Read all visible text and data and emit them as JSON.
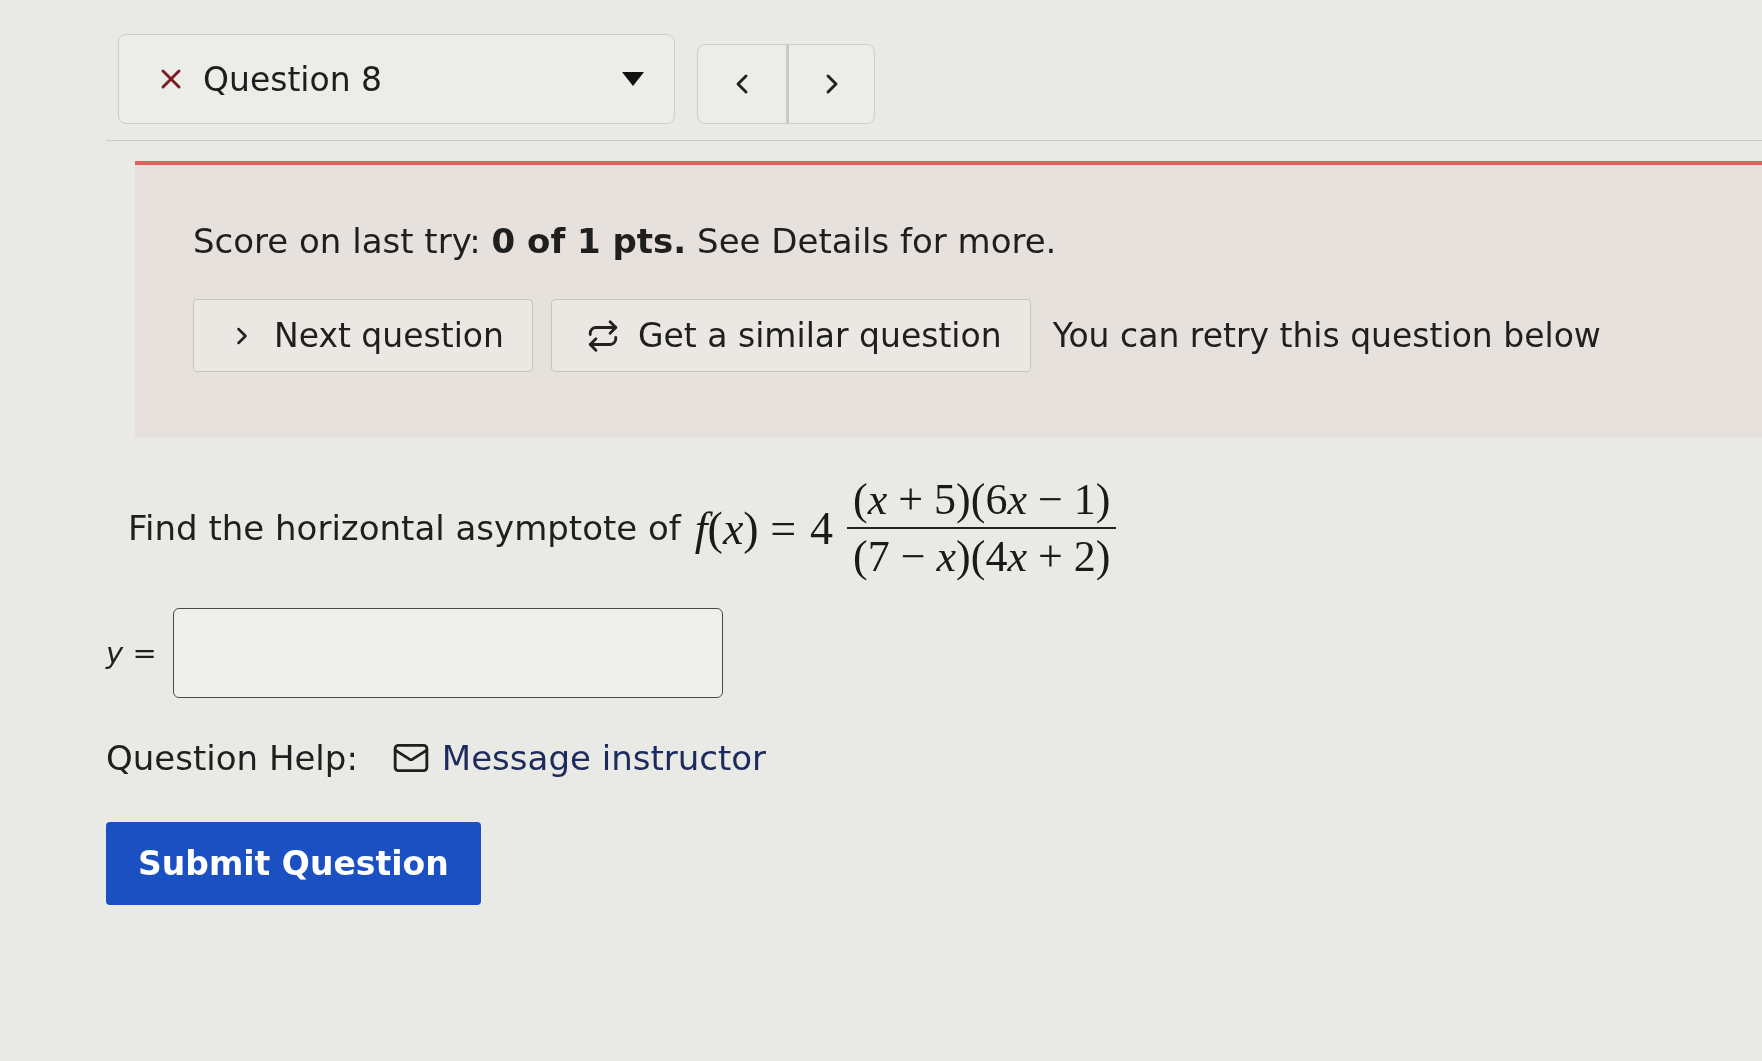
{
  "question_selector": {
    "label": "Question 8"
  },
  "score_alert": {
    "message": "Score on last try: **0 of 1 pts.** See Details for more.",
    "buttons": [
      {
        "kind": "next",
        "label": "Next question"
      },
      {
        "kind": "similar",
        "label": "Get a similar question"
      }
    ],
    "note": "You can retry this question below"
  },
  "question": {
    "prompt": "Find the horizontal asymptote of",
    "formula": {
      "lhs": "f(x) =",
      "coefficient": "4",
      "numerator": "(x + 5)(6x − 1)",
      "denominator": "(7 − x)(4x + 2)"
    }
  },
  "answer": {
    "label": "y ="
  },
  "help": {
    "label": "Question Help:",
    "link": "Message instructor"
  },
  "submit_button": "Submit Question"
}
